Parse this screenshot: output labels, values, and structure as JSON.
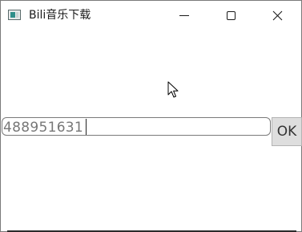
{
  "window": {
    "title": "Bili音乐下载",
    "app_icon": "app-window-icon",
    "controls": {
      "minimize_icon": "minimize-icon",
      "maximize_icon": "maximize-icon",
      "close_icon": "close-icon"
    }
  },
  "form": {
    "input_value": "488951631",
    "ok_label": "OK"
  },
  "cursor": {
    "icon": "mouse-pointer-icon"
  },
  "colors": {
    "input_text": "#777777",
    "button_bg": "#dedede",
    "border": "#7a7a7a"
  }
}
